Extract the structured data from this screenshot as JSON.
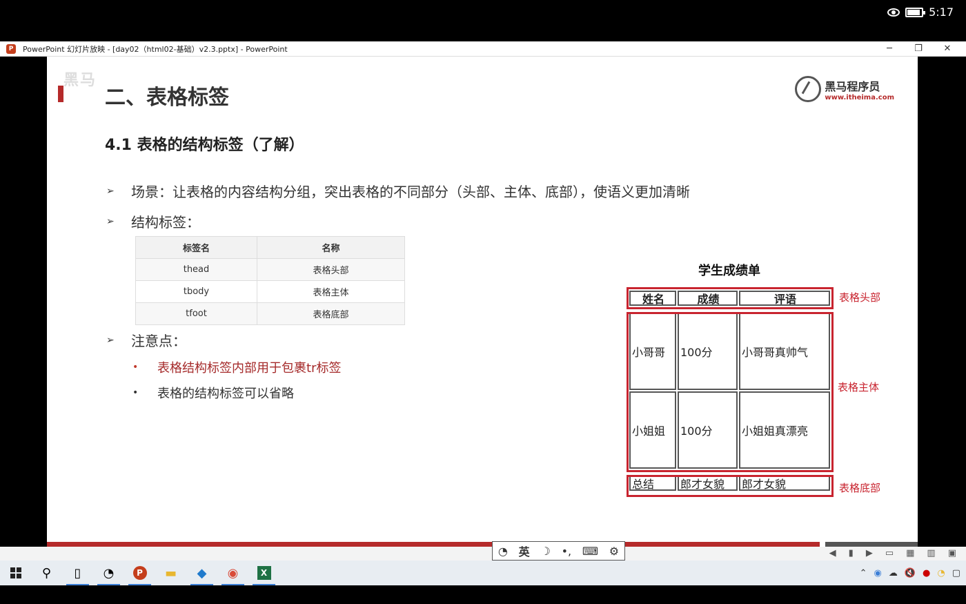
{
  "status": {
    "time": "5:17"
  },
  "window": {
    "app_icon_letter": "P",
    "title": "PowerPoint 幻灯片放映 - [day02（html02-基础）v2.3.pptx] - PowerPoint",
    "minimize": "─",
    "restore": "❐",
    "close": "✕"
  },
  "slide": {
    "watermark": "黑马",
    "title": "二、表格标签",
    "logo": {
      "name": "黑马程序员",
      "url": "www.itheima.com"
    },
    "subtitle": "4.1 表格的结构标签（了解）",
    "bullets": [
      "场景：让表格的内容结构分组，突出表格的不同部分（头部、主体、底部），使语义更加清晰",
      "结构标签：",
      "注意点："
    ],
    "bullet_marker": "➢",
    "sub_bullets": [
      "表格结构标签内部用于包裹tr标签",
      "表格的结构标签可以省略"
    ],
    "sub_marker": "•",
    "tag_table": {
      "headers": [
        "标签名",
        "名称"
      ],
      "rows": [
        [
          "thead",
          "表格头部"
        ],
        [
          "tbody",
          "表格主体"
        ],
        [
          "tfoot",
          "表格底部"
        ]
      ]
    },
    "demo_table": {
      "caption": "学生成绩单",
      "head": [
        "姓名",
        "成绩",
        "评语"
      ],
      "body": [
        [
          "小哥哥",
          "100分",
          "小哥哥真帅气"
        ],
        [
          "小姐姐",
          "100分",
          "小姐姐真漂亮"
        ]
      ],
      "foot": [
        "总结",
        "郎才女貌",
        "郎才女貌"
      ],
      "labels": {
        "head": "表格头部",
        "body": "表格主体",
        "foot": "表格底部"
      }
    }
  },
  "ime": {
    "mode": "英",
    "moon": "☽",
    "punct": "•,",
    "keyboard": "⌨",
    "settings": "⚙"
  },
  "view_icons": [
    "◀",
    "▮",
    "▶",
    "▭",
    "▦",
    "▥",
    "▣"
  ],
  "taskbar": {
    "search": "⚲",
    "file": "▯",
    "ppt": "P",
    "explorer": "▬",
    "vscode": "◆",
    "chrome": "◉",
    "excel": "X"
  },
  "tray": [
    "⌃",
    "◉",
    "☁",
    "🔇",
    "●",
    "◔",
    "▢"
  ],
  "colors": {
    "accent_red": "#c8242f",
    "brand_red": "#b52a2a"
  }
}
